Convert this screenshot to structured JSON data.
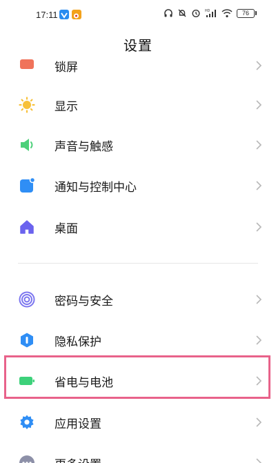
{
  "status_bar": {
    "time": "17:11",
    "battery_level": "76"
  },
  "header": {
    "title": "设置"
  },
  "settings_groups": [
    {
      "items": [
        {
          "label": "锁屏",
          "icon": "lock-screen-icon",
          "color": "#f0735a"
        },
        {
          "label": "显示",
          "icon": "sun-icon",
          "color": "#f7c13a"
        },
        {
          "label": "声音与触感",
          "icon": "speaker-icon",
          "color": "#4dd07a"
        },
        {
          "label": "通知与控制中心",
          "icon": "notification-icon",
          "color": "#2f8ef5"
        },
        {
          "label": "桌面",
          "icon": "home-icon",
          "color": "#6b63ee"
        }
      ]
    },
    {
      "items": [
        {
          "label": "密码与安全",
          "icon": "fingerprint-icon",
          "color": "#7b75ef"
        },
        {
          "label": "隐私保护",
          "icon": "shield-icon",
          "color": "#2f8ef5"
        },
        {
          "label": "省电与电池",
          "icon": "battery-icon",
          "color": "#3dd17a"
        },
        {
          "label": "应用设置",
          "icon": "gear-icon",
          "color": "#2f8ef5"
        },
        {
          "label": "更多设置",
          "icon": "more-icon",
          "color": "#8d90a8"
        }
      ]
    }
  ],
  "highlight_color": "#e8628a"
}
